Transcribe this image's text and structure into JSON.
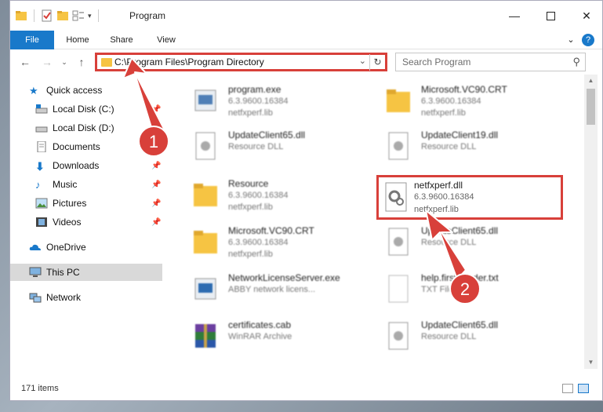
{
  "window": {
    "title": "Program"
  },
  "ribbon": {
    "tabs": [
      "File",
      "Home",
      "Share",
      "View"
    ]
  },
  "address": {
    "path": "C:\\Program Files\\Program Directory"
  },
  "search": {
    "placeholder": "Search Program"
  },
  "sidebar": {
    "items": [
      {
        "label": "Quick access",
        "icon": "star-icon",
        "pinned": false
      },
      {
        "label": "Local Disk (C:)",
        "icon": "drive-icon",
        "pinned": true
      },
      {
        "label": "Local Disk (D:)",
        "icon": "drive-icon",
        "pinned": false
      },
      {
        "label": "Documents",
        "icon": "document-icon",
        "pinned": true
      },
      {
        "label": "Downloads",
        "icon": "download-icon",
        "pinned": true
      },
      {
        "label": "Music",
        "icon": "music-icon",
        "pinned": true
      },
      {
        "label": "Pictures",
        "icon": "picture-icon",
        "pinned": true
      },
      {
        "label": "Videos",
        "icon": "video-icon",
        "pinned": true
      },
      {
        "label": "OneDrive",
        "icon": "cloud-icon",
        "pinned": false
      },
      {
        "label": "This PC",
        "icon": "computer-icon",
        "pinned": false,
        "selected": true
      },
      {
        "label": "Network",
        "icon": "network-icon",
        "pinned": false
      }
    ]
  },
  "files": [
    {
      "name": "program.exe",
      "line1": "6.3.9600.16384",
      "line2": "netfxperf.lib",
      "icon": "exe-icon"
    },
    {
      "name": "Microsoft.VC90.CRT",
      "line1": "6.3.9600.16384",
      "line2": "netfxperf.lib",
      "icon": "folder-icon"
    },
    {
      "name": "UpdateClient65.dll",
      "line1": "Resource DLL",
      "line2": "",
      "icon": "dll-icon"
    },
    {
      "name": "UpdateClient19.dll",
      "line1": "Resource DLL",
      "line2": "",
      "icon": "dll-icon"
    },
    {
      "name": "Resource",
      "line1": "6.3.9600.16384",
      "line2": "netfxperf.lib",
      "icon": "folder-icon"
    },
    {
      "name": "Microsoft.VC90.CRT",
      "line1": "6.3.9600.16384",
      "line2": "netfxperf.lib",
      "icon": "folder-icon"
    },
    {
      "name": "UpdateClient65.dll",
      "line1": "Resource DLL",
      "line2": "",
      "icon": "dll-icon"
    },
    {
      "name": "NetworkLicenseServer.exe",
      "line1": "ABBY network licens...",
      "line2": "",
      "icon": "exe-icon"
    },
    {
      "name": "help.first.reader.txt",
      "line1": "TXT File",
      "line2": "",
      "icon": "txt-icon"
    },
    {
      "name": "certificates.cab",
      "line1": "WinRAR Archive",
      "line2": "",
      "icon": "archive-icon"
    },
    {
      "name": "UpdateClient65.dll",
      "line1": "Resource DLL",
      "line2": "",
      "icon": "dll-icon"
    }
  ],
  "highlighted_file": {
    "name": "netfxperf.dll",
    "line1": "6.3.9600.16384",
    "line2": "netfxperf.lib",
    "icon": "gear-file-icon"
  },
  "status": {
    "count": "171 items"
  },
  "callouts": {
    "first": "1",
    "second": "2"
  },
  "colors": {
    "accent": "#1979ca",
    "callout": "#d8403a"
  }
}
